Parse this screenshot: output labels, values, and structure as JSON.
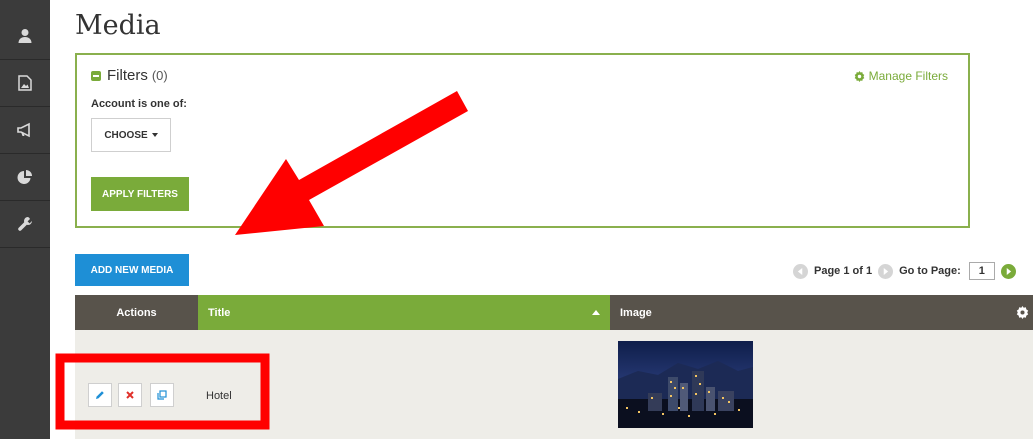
{
  "sidebar": {
    "items": [
      {
        "icon": "user-icon"
      },
      {
        "icon": "image-file-icon"
      },
      {
        "icon": "megaphone-icon"
      },
      {
        "icon": "pie-chart-icon"
      },
      {
        "icon": "wrench-icon"
      }
    ]
  },
  "page": {
    "title": "Media"
  },
  "filters": {
    "title": "Filters",
    "count": "(0)",
    "manage_label": "Manage Filters",
    "account_label": "Account is one of:",
    "choose_label": "CHOOSE",
    "apply_label": "APPLY FILTERS"
  },
  "toolbar": {
    "add_label": "ADD NEW MEDIA"
  },
  "pager": {
    "page_text": "Page 1 of 1",
    "goto_label": "Go to Page:",
    "page_value": "1"
  },
  "table": {
    "columns": [
      "Actions",
      "Title",
      "Image"
    ],
    "rows": [
      {
        "title": "Hotel",
        "image": "city-night-skyline"
      }
    ]
  },
  "colors": {
    "accent_green": "#7aab3a",
    "accent_blue": "#1e8fd6",
    "annotation_red": "#ff0000",
    "sidebar": "#3b3b3b"
  }
}
